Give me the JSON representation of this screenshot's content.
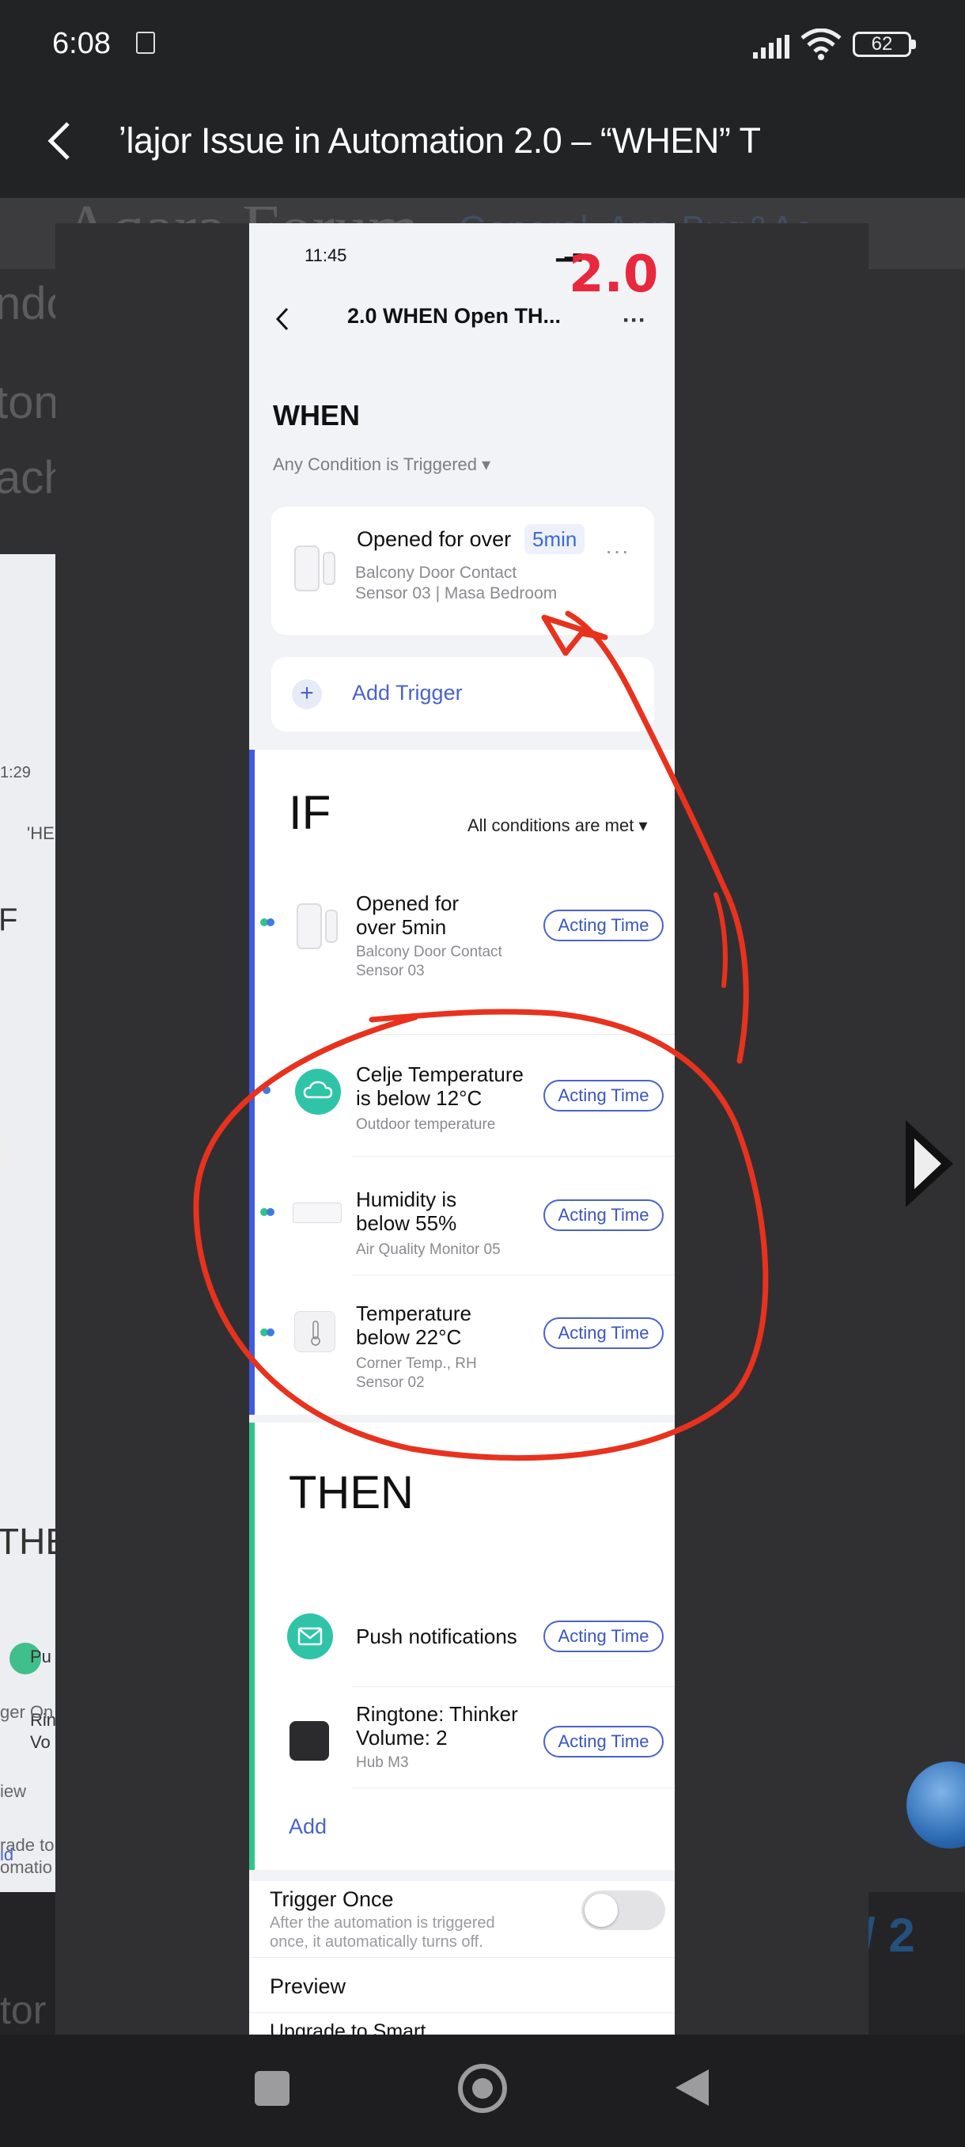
{
  "status_bar": {
    "time": "6:08",
    "battery": "62"
  },
  "title_bar": {
    "title": "ʼlajor Issue in Automation 2.0 – “WHEN” T"
  },
  "background": {
    "logo": "Aqara Forum",
    "category": "General, App Bug&Ac...",
    "fragments": [
      "ndo",
      "ton",
      "ach",
      "1:29",
      "'HE",
      "F",
      "THE",
      "Pu",
      "Rin",
      "Vo",
      "id",
      "ger On",
      "iew",
      "rade to",
      "omatio",
      "tor",
      "/ 2"
    ]
  },
  "phone": {
    "time": "11:45",
    "version_label": "2.0",
    "nav_title": "2.0 WHEN Open  TH...",
    "more": "···",
    "when": {
      "title": "WHEN",
      "condition": "Any Condition is Triggered ▾",
      "trigger": {
        "title": "Opened for over",
        "duration": "5min",
        "device": "Balcony Door Contact",
        "location": "Sensor 03 | Masa Bedroom",
        "more": "···"
      },
      "add_trigger": "Add Trigger"
    },
    "if": {
      "title": "IF",
      "condition": "All conditions are met",
      "rows": [
        {
          "line1": "Opened for",
          "line2": "over 5min",
          "sub1": "Balcony Door Contact",
          "sub2": "Sensor 03",
          "action": "Acting Time"
        },
        {
          "line1": "Celje Temperature",
          "line2": "is below 12°C",
          "sub1": "Outdoor temperature",
          "sub2": "",
          "action": "Acting Time"
        },
        {
          "line1": "Humidity is",
          "line2": "below 55%",
          "sub1": "Air Quality Monitor 05",
          "sub2": "",
          "action": "Acting Time"
        },
        {
          "line1": "Temperature",
          "line2": "below 22°C",
          "sub1": "Corner Temp., RH",
          "sub2": "Sensor 02",
          "action": "Acting Time"
        }
      ]
    },
    "then": {
      "title": "THEN",
      "rows": [
        {
          "line1": "Push notifications",
          "line2": "",
          "sub1": "",
          "action": "Acting Time"
        },
        {
          "line1": "Ringtone: Thinker",
          "line2": "Volume: 2",
          "sub1": "Hub M3",
          "action": "Acting Time"
        }
      ],
      "add": "Add"
    },
    "trigger_once": {
      "title": "Trigger Once",
      "desc1": "After the automation is triggered",
      "desc2": "once, it automatically turns off.",
      "enabled": false
    },
    "preview": "Preview",
    "upgrade": "Upgrade to Smart..."
  },
  "colors": {
    "accent_blue": "#4a63c9",
    "if_bar": "#3f5be0",
    "then_bar": "#2fc48c",
    "annotation_red": "#e8321e",
    "version_red": "#e8283c"
  }
}
